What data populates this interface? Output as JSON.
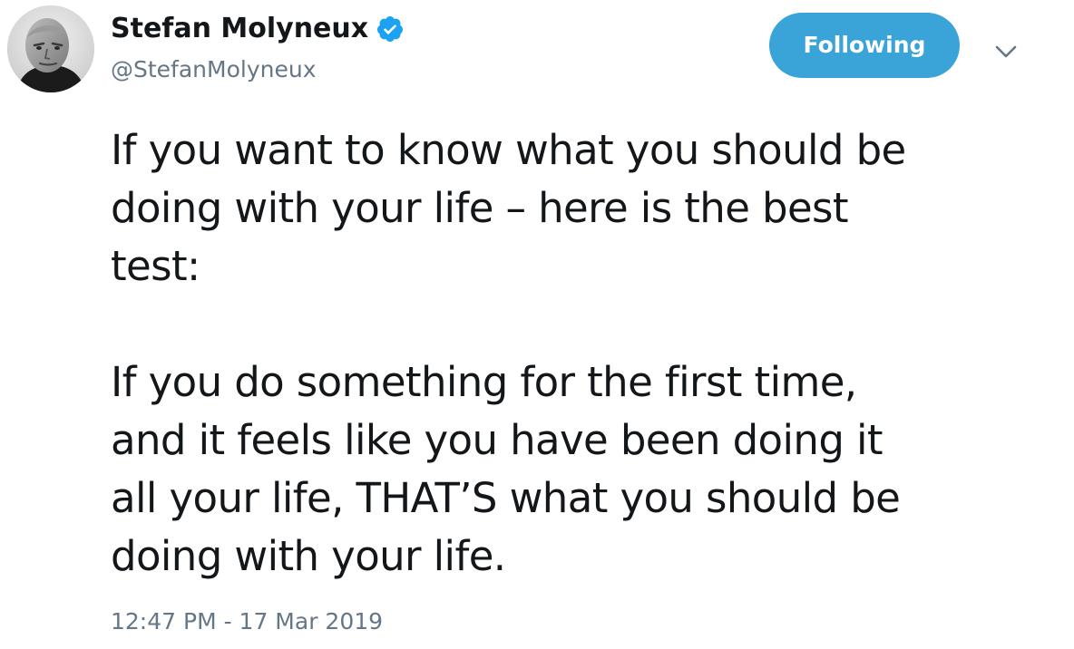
{
  "author": {
    "display_name": "Stefan Molyneux",
    "handle": "@StefanMolyneux",
    "avatar_icon": "profile-photo",
    "verified_icon": "verified-badge-icon"
  },
  "actions": {
    "follow_label": "Following",
    "more_icon": "chevron-down-icon"
  },
  "tweet": {
    "paragraphs": [
      "If you want to know what you should be\ndoing with your life – here is the best\ntest:",
      "If you do something for the first time,\nand it feels like you have been doing it\nall your life, THAT’S what you should be\ndoing with your life."
    ],
    "timestamp": "12:47 PM - 17 Mar 2019"
  },
  "colors": {
    "accent": "#3aa3d8",
    "text": "#14171a",
    "muted": "#657786",
    "verified": "#1da1f2"
  }
}
